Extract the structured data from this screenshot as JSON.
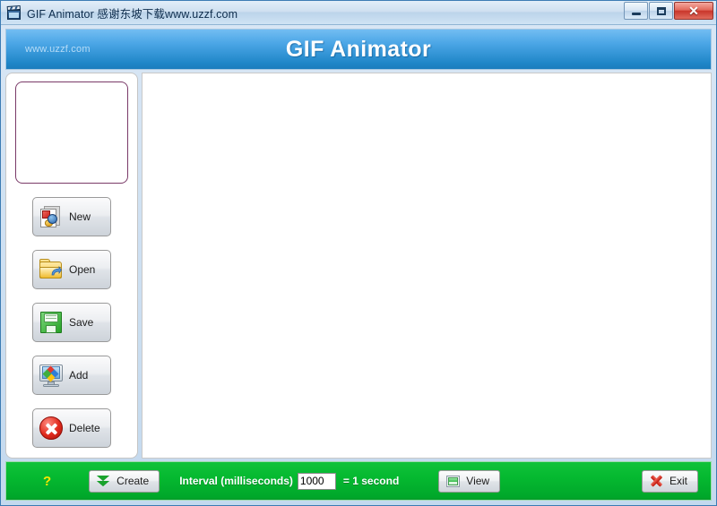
{
  "window": {
    "title": "GIF Animator 感谢东坡下载www.uzzf.com",
    "app_icon": "film-clapper-icon",
    "controls": {
      "minimize": "minimize-icon",
      "maximize": "maximize-icon",
      "close_label": "✕"
    }
  },
  "banner": {
    "title": "GIF Animator",
    "watermark": "www.uzzf.com",
    "gradient_top": "#72bdf2",
    "gradient_bottom": "#1b7cbd"
  },
  "sidebar": {
    "preview_border_color": "#7a3a68",
    "buttons": [
      {
        "label": "New",
        "icon": "new-document-icon"
      },
      {
        "label": "Open",
        "icon": "open-folder-icon"
      },
      {
        "label": "Save",
        "icon": "floppy-disk-icon"
      },
      {
        "label": "Add",
        "icon": "monitor-add-icon"
      },
      {
        "label": "Delete",
        "icon": "red-x-circle-icon"
      }
    ]
  },
  "footer": {
    "help_label": "?",
    "help_color": "#ffe600",
    "create_label": "Create",
    "create_icon": "green-down-chevrons-icon",
    "interval_label": "Interval (milliseconds)",
    "interval_value": "1000",
    "interval_placeholder": "1000",
    "interval_equals": "= 1 second",
    "view_label": "View",
    "view_icon": "green-picture-icon",
    "exit_label": "Exit",
    "exit_icon": "red-x-icon",
    "gradient_top": "#10c23a",
    "gradient_bottom": "#019a27"
  }
}
